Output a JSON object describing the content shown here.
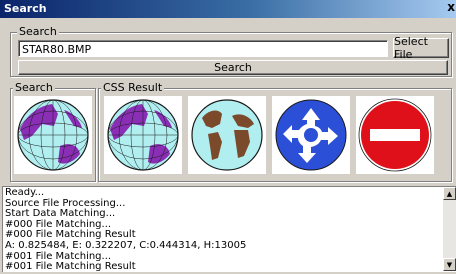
{
  "window": {
    "title": "Search",
    "close_glyph": "x"
  },
  "search_group": {
    "label": "Search",
    "file_value": "STAR80.BMP",
    "select_file_label": "Select File",
    "search_button_label": "Search"
  },
  "result_group": {
    "search_label": "Search",
    "css_label": "CSS Result",
    "query_image": "globe-pacific",
    "results": [
      "globe-pacific",
      "globe-atlantic-africa",
      "roundabout-sign",
      "no-entry-sign"
    ]
  },
  "log": {
    "lines": [
      "Ready...",
      "Source File Processing...",
      "Start Data Matching...",
      "#000 File Matching...",
      "#000 File Matching Result",
      "A: 0.825484, E: 0.322207, C:0.444314, H:13005",
      "#001 File Matching...",
      "#001 File Matching Result"
    ]
  },
  "colors": {
    "globe_ocean": "#b0eef0",
    "globe_land_purple": "#8a2fb5",
    "globe_land_brown": "#7b4a2a",
    "sign_blue": "#2b4fd6",
    "sign_red": "#e0101a"
  }
}
